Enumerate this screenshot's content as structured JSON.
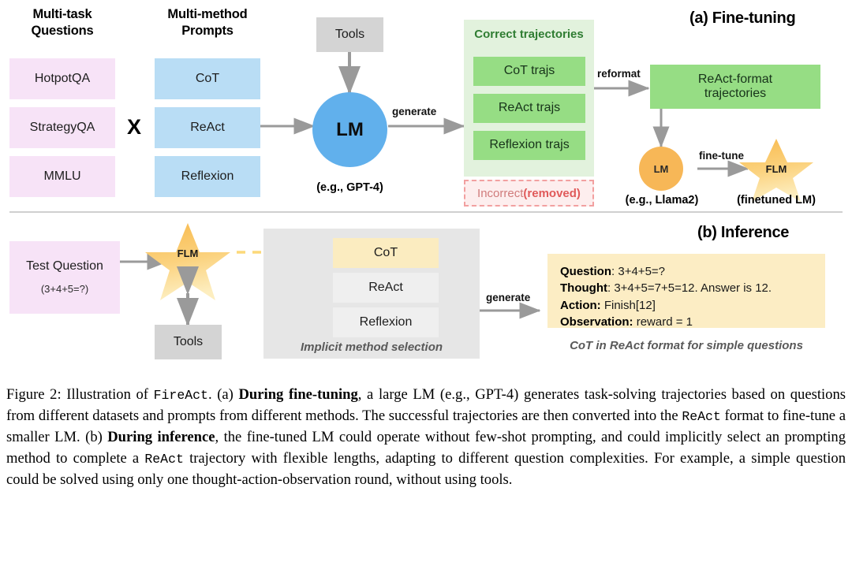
{
  "figure": {
    "headers": {
      "questions": "Multi-task\nQuestions",
      "prompts": "Multi-method\nPrompts"
    },
    "datasets": [
      "HotpotQA",
      "StrategyQA",
      "MMLU"
    ],
    "cross_symbol": "X",
    "methods": [
      "CoT",
      "ReAct",
      "Reflexion"
    ],
    "tools_top": "Tools",
    "lm_big": "LM",
    "lm_big_note": "(e.g., GPT-4)",
    "generate_label": "generate",
    "correct_panel_title": "Correct trajectories",
    "correct_trajs": [
      "CoT trajs",
      "ReAct trajs",
      "Reflexion trajs"
    ],
    "incorrect_prefix": "Incorrect ",
    "incorrect_bold": "(removed)",
    "reformat_label": "reformat",
    "section_a_title": "(a) Fine-tuning",
    "react_format_box": "ReAct-format\ntrajectories",
    "lm_small": "LM",
    "lm_small_note": "(e.g., Llama2)",
    "finetune_label": "fine-tune",
    "flm_a": "FLM",
    "flm_a_note": "(finetuned LM)",
    "section_b_title": "(b) Inference",
    "test_question_title": "Test Question",
    "test_question_sub": "(3+4+5=?)",
    "flm_b": "FLM",
    "tools_bottom": "Tools",
    "selector_methods": [
      "CoT",
      "ReAct",
      "Reflexion"
    ],
    "selector_note": "Implicit method selection",
    "generate_label_b": "generate",
    "output_lines": [
      {
        "label": "Question",
        "sep": ": ",
        "text": "3+4+5=?"
      },
      {
        "label": "Thought",
        "sep": ": ",
        "text": "3+4+5=7+5=12. Answer is 12."
      },
      {
        "label": "Action:",
        "sep": " ",
        "text": "Finish[12]"
      },
      {
        "label": "Observation:",
        "sep": " ",
        "text": "reward = 1"
      }
    ],
    "output_note": "CoT in ReAct format for simple questions"
  },
  "caption": {
    "p1_a": "Figure 2: Illustration of ",
    "p1_mono1": "FireAct",
    "p1_b": ". (a) ",
    "p1_bold1": "During fine-tuning",
    "p1_c": ", a large LM (e.g., GPT-4) generates task-solving trajectories based on questions from different datasets and prompts from different methods. The successful trajectories are then converted into the ",
    "p1_mono2": "ReAct",
    "p1_d": " format to fine-tune a smaller LM. (b) ",
    "p1_bold2": "During inference",
    "p1_e": ", the fine-tuned LM could operate without few-shot prompting, and could implicitly select an prompting method to complete a ",
    "p1_mono3": "ReAct",
    "p1_f": " trajectory with flexible lengths, adapting to different question complexities. For example, a simple question could be solved using only one thought-action-observation round, without using tools."
  },
  "colors": {
    "pink": "#f7e3f7",
    "blue": "#b9ddf5",
    "gray": "#d4d4d4",
    "green": "#96dd84",
    "green_panel": "#e2f2dd",
    "green_text": "#2f7d32",
    "lm_blue": "#61b0ec",
    "lm_orange": "#f7b757",
    "star_yellow": "#f9c96a",
    "yellow_box": "#fcedc4",
    "red_dash": "#f2a0a0",
    "arrow_gray": "#9a9a9a"
  }
}
